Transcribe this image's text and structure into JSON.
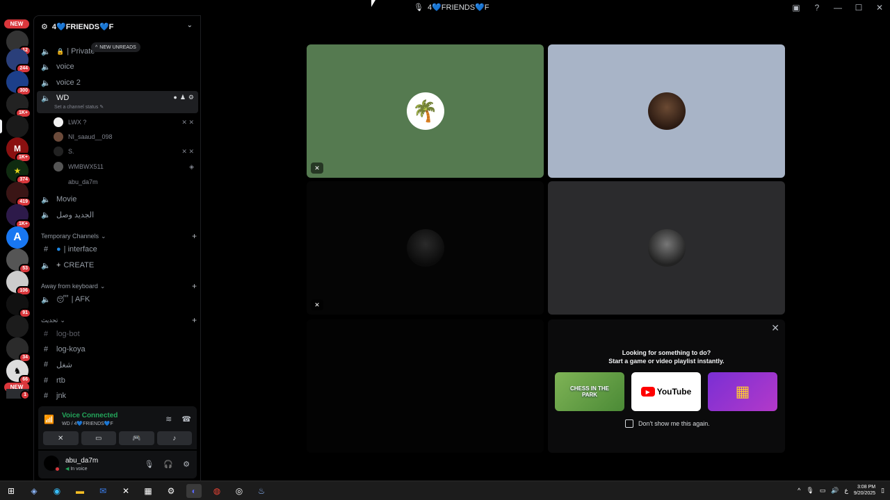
{
  "window": {
    "title": "4💙FRIENDS💙F"
  },
  "rail": {
    "new_label": "NEW",
    "badges": [
      "12",
      "244",
      "300",
      "1K+",
      "1K+",
      "374",
      "419",
      "1K+",
      "53",
      "106",
      "91",
      "34",
      "66",
      "1"
    ]
  },
  "guild": {
    "name": "4💙FRIENDS💙F",
    "new_unreads": "NEW UNREADS"
  },
  "channels": {
    "private": "| Private",
    "voice": "voice",
    "voice2": "voice 2",
    "wd": "WD",
    "wd_status": "Set a channel status",
    "users": [
      "LWX ?",
      "NI_saaud__098",
      "S.",
      "WMBWX511",
      "abu_da7m"
    ],
    "movie": "Movie",
    "arabic1": "الجديد وصل",
    "cat_temp": "Temporary Channels",
    "interface": "| interface",
    "create": "CREATE",
    "cat_afk": "Away from keyboard",
    "afk": "| AFK",
    "cat_arabic": "تحديث",
    "log_bot": "log-bot",
    "log_koya": "log-koya",
    "arabic2": "شغل",
    "rtb": "rtb",
    "jnk": "jnk"
  },
  "voice_panel": {
    "title": "Voice Connected",
    "subtitle": "WD / 4💙FRIENDS💙F"
  },
  "user_panel": {
    "name": "abu_da7m",
    "status": "In voice"
  },
  "activity": {
    "line1": "Looking for something to do?",
    "line2": "Start a game or video playlist instantly.",
    "youtube": "YouTube",
    "chess": "CHESS IN THE PARK",
    "dont_show": "Don't show me this again."
  },
  "taskbar": {
    "time": "3:08 PM",
    "date": "9/20/2025"
  },
  "colors": {
    "tile1": "#557a50",
    "tile2": "#a8b4c7",
    "tile4": "#2b2b2d",
    "voice_green": "#23a55a",
    "badge_red": "#da373c"
  }
}
